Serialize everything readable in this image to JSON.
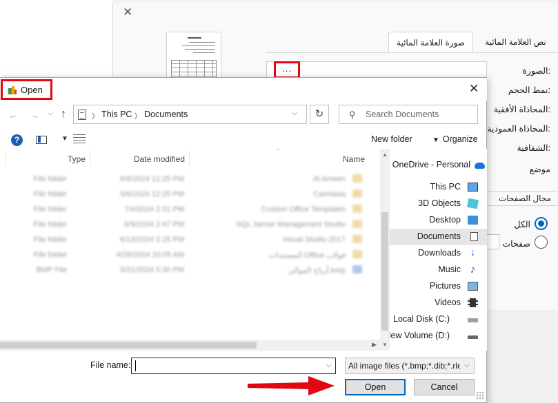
{
  "background_dialog": {
    "close_glyph": "✕",
    "tabs": [
      "صورة العلامة المائية",
      "نص العلامة المائية"
    ],
    "browse_label": "...",
    "labels": [
      "الصورة:",
      "نمط الحجم:",
      "المحاذاة الأفقية:",
      "المحاذاة العمودية:",
      "الشفافية:",
      "موضع"
    ],
    "section_title": "مجال الصفحات",
    "radio_all": "الكل",
    "radio_pages": "صفحات"
  },
  "open_dialog": {
    "title": "Open",
    "close_glyph": "✕",
    "breadcrumb": [
      "This PC",
      "Documents"
    ],
    "search_placeholder": "Search Documents",
    "toolbar": {
      "new_folder": "New folder",
      "organize": "Organize"
    },
    "columns": {
      "type": "Type",
      "date": "Date modified",
      "name": "Name"
    },
    "files": [
      {
        "type": "File folder",
        "date": "6/8/2024 12:25 PM",
        "name": "Al Ameen",
        "icon": "folder"
      },
      {
        "type": "File folder",
        "date": "5/6/2024 12:25 PM",
        "name": "Camtasia",
        "icon": "folder"
      },
      {
        "type": "File folder",
        "date": "7/4/2024 2:31 PM",
        "name": "Custom Office Templates",
        "icon": "folder"
      },
      {
        "type": "File folder",
        "date": "6/9/2024 2:47 PM",
        "name": "SQL Server Management Studio",
        "icon": "folder"
      },
      {
        "type": "File folder",
        "date": "6/13/2024 2:25 PM",
        "name": "Visual Studio 2017",
        "icon": "folder"
      },
      {
        "type": "File folder",
        "date": "4/28/2024 10:05 AM",
        "name": "المستندات Office قوالب",
        "icon": "folder"
      },
      {
        "type": "BMP File",
        "date": "9/21/2024 5:30 PM",
        "name": "أرباح الموالي.bmp",
        "icon": "bmp"
      }
    ],
    "nav_items": [
      {
        "label": "OneDrive - Personal",
        "icon": "onedrive-icon",
        "selected": false
      },
      {
        "label": "This PC",
        "icon": "this-pc-icon",
        "selected": false
      },
      {
        "label": "3D Objects",
        "icon": "3d-objects-icon",
        "selected": false
      },
      {
        "label": "Desktop",
        "icon": "desktop-icon",
        "selected": false
      },
      {
        "label": "Documents",
        "icon": "documents-icon",
        "selected": true
      },
      {
        "label": "Downloads",
        "icon": "downloads-icon",
        "selected": false
      },
      {
        "label": "Music",
        "icon": "music-icon",
        "selected": false
      },
      {
        "label": "Pictures",
        "icon": "pictures-icon",
        "selected": false
      },
      {
        "label": "Videos",
        "icon": "videos-icon",
        "selected": false
      },
      {
        "label": "Local Disk (C:)",
        "icon": "local-disk-icon",
        "selected": false
      },
      {
        "label": "New Volume (D:)",
        "icon": "new-volume-icon",
        "selected": false
      }
    ],
    "filename_label": "File name:",
    "filename_value": "",
    "filter_value": "All image files (*.bmp;*.dib;*.rle",
    "open_button": "Open",
    "cancel_button": "Cancel"
  },
  "colors": {
    "highlight": "#e30613",
    "accent": "#0067c0",
    "selected_nav": "#e5e5e5"
  }
}
